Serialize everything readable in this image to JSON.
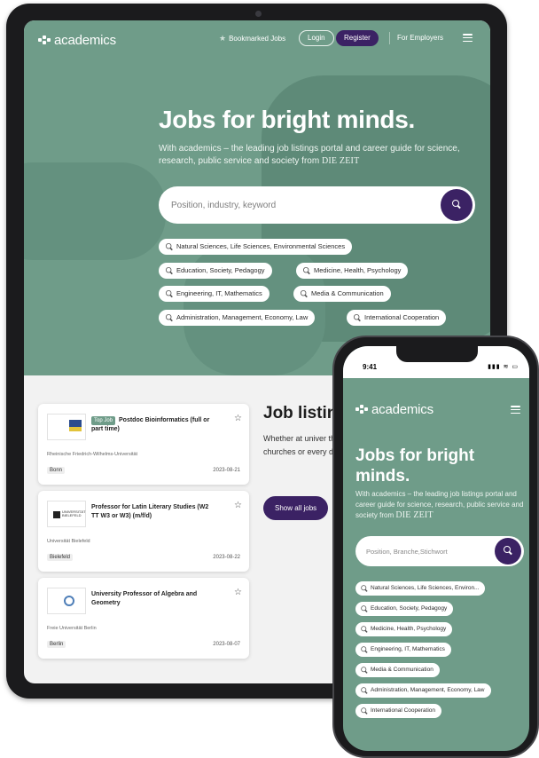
{
  "tablet": {
    "nav": {
      "logo": "academics",
      "bookmarked": "Bookmarked Jobs",
      "login": "Login",
      "register": "Register",
      "employers": "For Employers"
    },
    "hero": {
      "title": "Jobs for bright minds.",
      "subtitle": "With academics – the leading job listings portal and career guide for science, research, public service and society from",
      "brand": "DIE ZEIT",
      "search_placeholder": "Position, industry, keyword"
    },
    "chips": [
      "Natural Sciences, Life Sciences, Environmental Sciences",
      "Education, Society, Pedagogy",
      "Medicine, Health, Psychology",
      "Engineering, IT, Mathematics",
      "Media & Communication",
      "Administration, Management, Economy, Law",
      "International Cooperation"
    ],
    "jobs": [
      {
        "badge": "Top Job",
        "title": "Postdoc Bioinformatics (full or part time)",
        "institution": "Rheinische Friedrich-Wilhelms-Universität",
        "city": "Bonn",
        "date": "2023-08-21"
      },
      {
        "badge": "",
        "title": "Professor for Latin Literary Studies (W2 TT W3 or W3) (m/f/d)",
        "institution": "Universität Bielefeld",
        "city": "Bielefeld",
        "date": "2023-08-22",
        "logo_text": "UNIVERSITÄT BIELEFELD"
      },
      {
        "badge": "",
        "title": "University Professor of  Algebra and Geometry",
        "institution": "Freie Universität Berlin",
        "city": "Berlin",
        "date": "2023-08-07"
      }
    ],
    "listings": {
      "heading": "Job listin",
      "text": "Whether at univer the public sector, churches or every dream job here.",
      "button": "Show all jobs"
    }
  },
  "phone": {
    "status": {
      "time": "9:41",
      "indicators": "▮▮▮ ≋ ▭"
    },
    "logo": "academics",
    "title": "Jobs for bright minds.",
    "subtitle": "With academics – the leading job listings portal and career guide for science, research, public service and society from",
    "brand": "DIE ZEIT",
    "search_placeholder": "Position, Branche,Stichwort",
    "chips": [
      "Natural Sciences, Life Sciences, Environ...",
      "Education, Society, Pedagogy",
      "Medicine, Health, Psychology",
      "Engineering, IT, Mathematics",
      "Media & Communication",
      "Administration, Management, Economy, Law",
      "International Cooperation"
    ]
  },
  "icons": {
    "star": "☆",
    "bookmark_star": "★",
    "search": "search-icon",
    "menu": "hamburger-icon"
  },
  "colors": {
    "hero_green": "#6f9c89",
    "brand_purple": "#3b2264",
    "device_frame": "#1b1b1d"
  }
}
